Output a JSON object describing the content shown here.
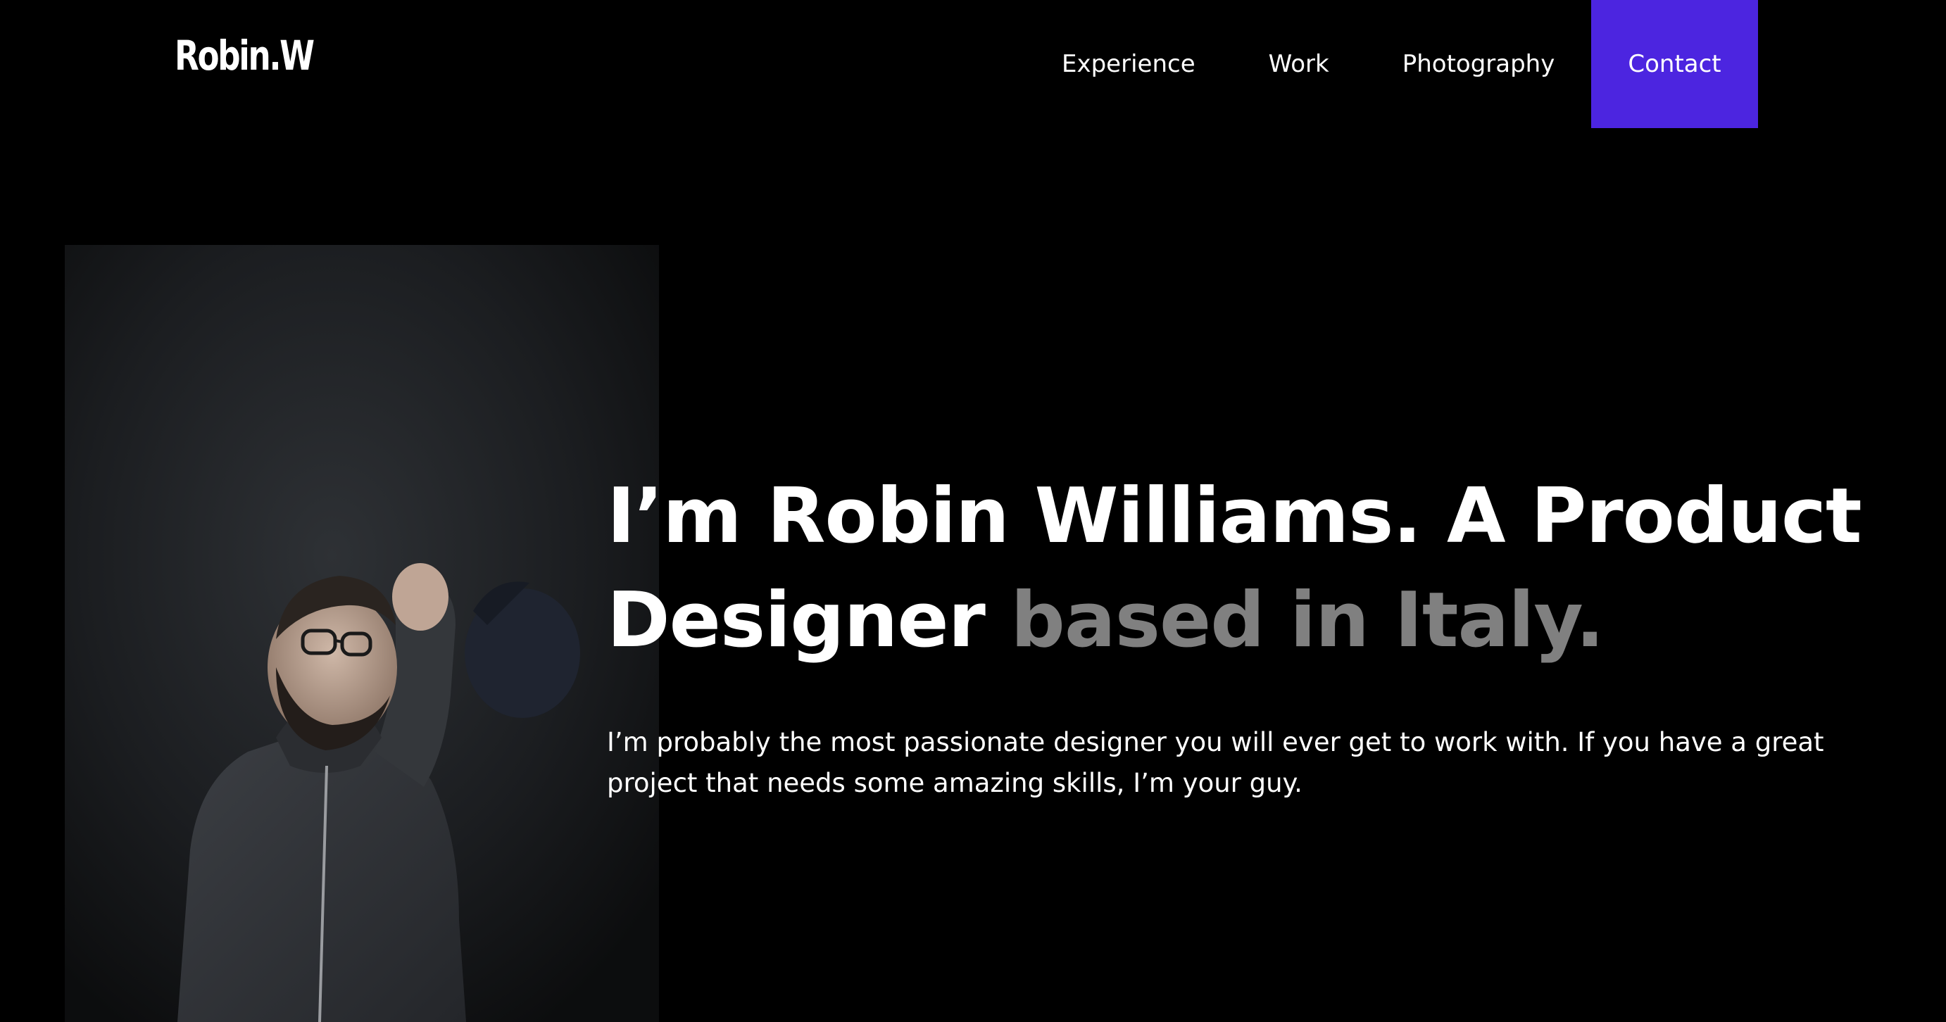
{
  "header": {
    "logo": "Robin.W",
    "nav": [
      {
        "label": "Experience"
      },
      {
        "label": "Work"
      },
      {
        "label": "Photography"
      },
      {
        "label": "Contact"
      }
    ]
  },
  "hero": {
    "headline_main": "I’m Robin Williams. A Product Designer ",
    "headline_muted": "based in Italy.",
    "intro": "I’m probably the most passionate designer you will ever get to work with. If you have a great project that needs some amazing skills, I’m your guy.",
    "portrait_icon": "portrait-photo"
  },
  "colors": {
    "background": "#000000",
    "text": "#ffffff",
    "muted_text": "#808080",
    "accent": "#4c25e0"
  }
}
